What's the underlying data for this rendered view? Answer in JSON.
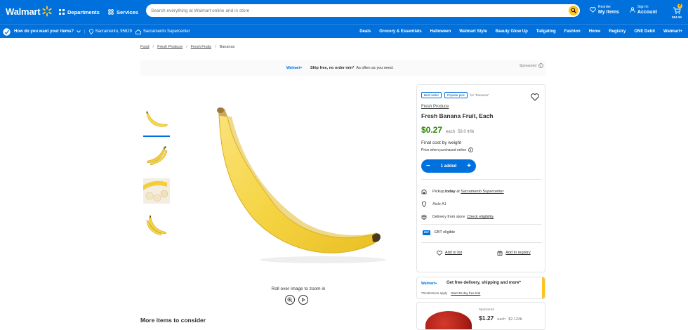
{
  "header": {
    "logo_text": "Walmart",
    "departments_label": "Departments",
    "services_label": "Services",
    "search_placeholder": "Search everything at Walmart online and in store",
    "reorder_small": "Reorder",
    "reorder_big": "My Items",
    "signin_small": "Sign In",
    "signin_big": "Account",
    "cart_count": "2",
    "cart_amount": "$54.34",
    "brand_color": "#0071dc",
    "accent_color": "#ffc220"
  },
  "subnav": {
    "fulfillment_prompt": "How do you want your items?",
    "location": "Sacramento, 95829",
    "store": "Sacramento Supercenter",
    "links": [
      "Deals",
      "Grocery & Essentials",
      "Halloween",
      "Walmart Style",
      "Beauty Glow Up",
      "Tailgating",
      "Fashion",
      "Home",
      "Registry",
      "ONE Debit",
      "Walmart+"
    ]
  },
  "breadcrumb": [
    "Food",
    "Fresh Produce",
    "Fresh Fruits",
    "Bananas"
  ],
  "promo": {
    "badge": "Walmart+",
    "bold": "Ship free, no order min*",
    "rest": "As often as you need.",
    "sponsored": "Sponsored"
  },
  "gallery": {
    "zoom_hint": "Roll over image to zoom in",
    "thumbs": [
      "single-banana",
      "banana-bunch",
      "banana-slices",
      "banana-pair"
    ]
  },
  "more_items": "More items to consider",
  "product": {
    "tags": [
      "Best seller",
      "Popular pick"
    ],
    "tag_suffix": "for \"bananas\"",
    "category": "Fresh Produce",
    "title": "Fresh Banana Fruit, Each",
    "price": "$0.27",
    "price_each": "each",
    "unit_price": "58.0 ¢/lb",
    "final_cost": "Final cost by weight",
    "price_when": "Price when purchased online",
    "stepper_label": "1 added",
    "quantity": 1,
    "pickup_prefix": "Pickup, ",
    "pickup_bold": "today",
    "pickup_at": " at ",
    "pickup_store": "Sacramento Supercenter",
    "aisle": "Aisle A1",
    "delivery_prefix": "Delivery from store",
    "delivery_link": "Check eligibility",
    "ebt_badge": "EBT",
    "ebt_text": "EBT eligible",
    "add_list": "Add to list",
    "add_registry": "Add to registry",
    "price_color": "#2a8703"
  },
  "plus_card": {
    "badge": "Walmart+",
    "title": "Get free delivery, shipping and more*",
    "restrictions": "*Restrictions apply",
    "trial_link": "Start 30-day free trial"
  },
  "sponsored_card": {
    "label": "Sponsored",
    "price": "$1.27",
    "each": "each",
    "unit_price": "$2.12/lb"
  }
}
